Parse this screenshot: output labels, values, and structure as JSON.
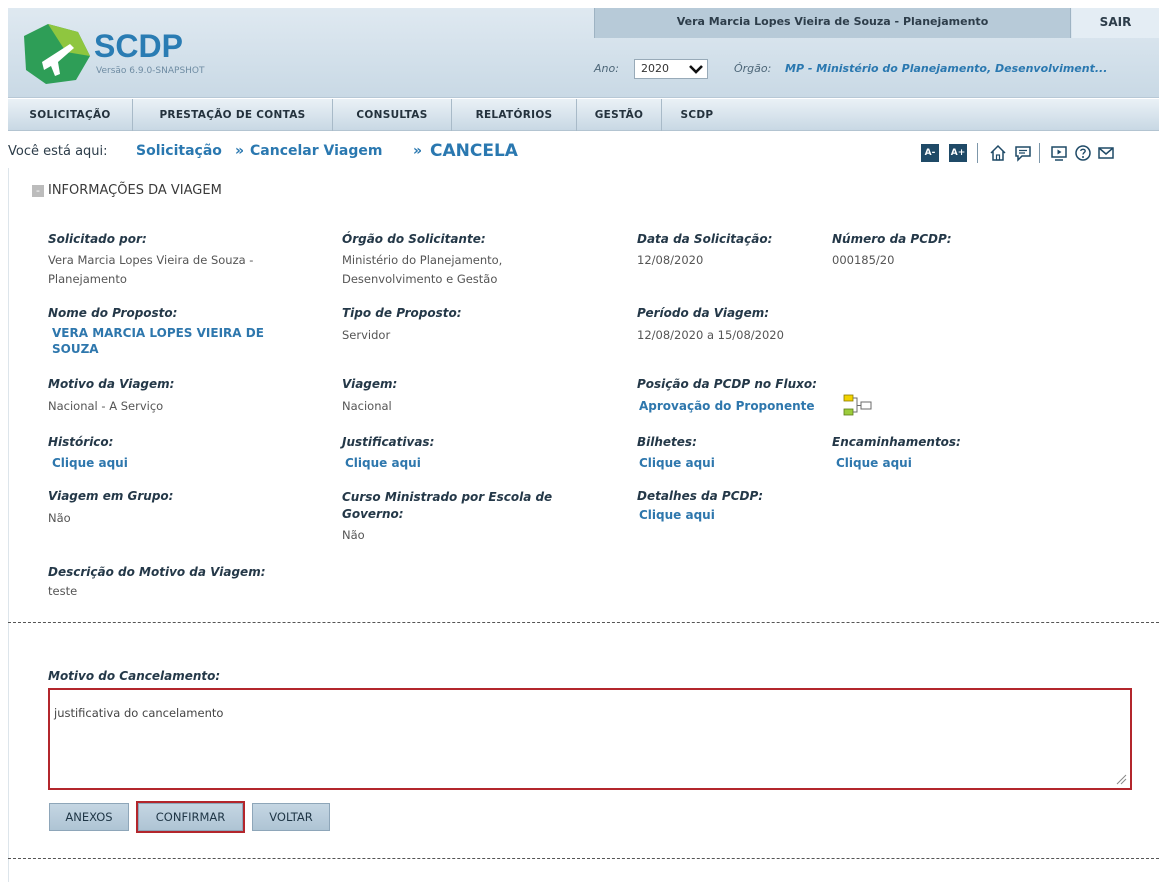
{
  "app": {
    "logo_text": "SCDP",
    "version": "Versão 6.9.0-SNAPSHOT",
    "user": "Vera Marcia Lopes Vieira de Souza - Planejamento",
    "logout_label": "SAIR",
    "year_label": "Ano:",
    "year_value": "2020",
    "organ_label": "Órgão:",
    "organ_value": "MP - Ministério do Planejamento, Desenvolviment..."
  },
  "nav": {
    "items": [
      "SOLICITAÇÃO",
      "PRESTAÇÃO DE CONTAS",
      "CONSULTAS",
      "RELATÓRIOS",
      "GESTÃO",
      "SCDP"
    ]
  },
  "breadcrumb": {
    "intro": "Você está aqui:",
    "items": [
      "Solicitação",
      "Cancelar Viagem"
    ],
    "separator": "»",
    "current": "CANCELA"
  },
  "toolbar": {
    "decrease_font": "A-",
    "increase_font": "A+",
    "icons": [
      "home-icon",
      "chat-icon",
      "video-icon",
      "help-icon",
      "mail-icon"
    ]
  },
  "section": {
    "collapse_symbol": "-",
    "title": "INFORMAÇÕES DA VIAGEM"
  },
  "fields": {
    "solicitado_por": {
      "label": "Solicitado por:",
      "lines": [
        "Vera Marcia Lopes Vieira de Souza -",
        "Planejamento"
      ]
    },
    "orgao_solicitante": {
      "label": "Órgão do Solicitante:",
      "lines": [
        "Ministério do Planejamento,",
        "Desenvolvimento e Gestão"
      ]
    },
    "data_solicitacao": {
      "label": "Data da Solicitação:",
      "value": "12/08/2020"
    },
    "numero_pcdp": {
      "label": "Número da PCDP:",
      "value": "000185/20"
    },
    "nome_proposto": {
      "label": "Nome do Proposto:",
      "lines": [
        "VERA MARCIA LOPES VIEIRA DE",
        "SOUZA"
      ]
    },
    "tipo_proposto": {
      "label": "Tipo de Proposto:",
      "value": "Servidor"
    },
    "periodo_viagem": {
      "label": "Período da Viagem:",
      "value": "12/08/2020 a 15/08/2020"
    },
    "motivo_viagem": {
      "label": "Motivo da Viagem:",
      "value": "Nacional - A Serviço"
    },
    "viagem": {
      "label": "Viagem:",
      "value": "Nacional"
    },
    "posicao_fluxo": {
      "label": "Posição da PCDP no Fluxo:",
      "value": "Aprovação do Proponente"
    },
    "historico": {
      "label": "Histórico:",
      "link": "Clique aqui"
    },
    "justificativas": {
      "label": "Justificativas:",
      "link": "Clique aqui"
    },
    "bilhetes": {
      "label": "Bilhetes:",
      "link": "Clique aqui"
    },
    "encaminhamentos": {
      "label": "Encaminhamentos:",
      "link": "Clique aqui"
    },
    "viagem_grupo": {
      "label": "Viagem em Grupo:",
      "value": "Não"
    },
    "curso_ministrado": {
      "label_lines": [
        "Curso Ministrado por Escola de",
        "Governo:"
      ],
      "value": "Não"
    },
    "detalhes_pcdp": {
      "label": "Detalhes da PCDP:",
      "link": "Clique aqui"
    },
    "descricao_motivo": {
      "label": "Descrição do Motivo da Viagem:",
      "value": "teste"
    }
  },
  "cancel": {
    "label": "Motivo do Cancelamento:",
    "text": "justificativa do cancelamento"
  },
  "buttons": {
    "anexos": "ANEXOS",
    "confirmar": "CONFIRMAR",
    "voltar": "VOLTAR"
  },
  "colors": {
    "accent_blue": "#2a78b0",
    "highlight_red": "#b3262c",
    "logo_green": "#2e9e57"
  }
}
